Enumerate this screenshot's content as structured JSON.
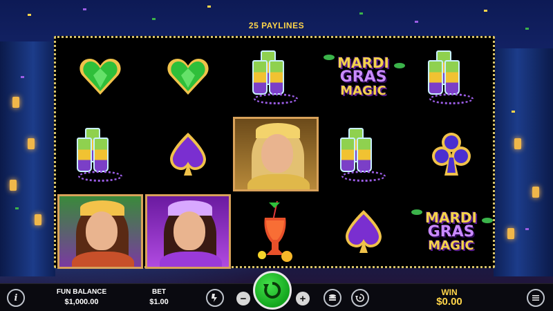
{
  "header": {
    "paylines": "25 PAYLINES"
  },
  "reels": {
    "symbols": [
      [
        "green-heart-gem",
        "green-heart-gem",
        "mardi-gras-shots",
        "mardi-gras-magic-logo",
        "mardi-gras-shots"
      ],
      [
        "mardi-gras-shots",
        "purple-spade",
        "masked-queen-portrait",
        "mardi-gras-shots",
        "purple-club"
      ],
      [
        "showgirl-portrait",
        "purple-showgirl-portrait",
        "hurricane-cocktail",
        "purple-spade",
        "mardi-gras-magic-logo"
      ]
    ]
  },
  "logo": {
    "line1": "MARDI",
    "line2": "GRAS",
    "line3": "MAGIC"
  },
  "bottom_bar": {
    "info_icon": "info-icon",
    "fun_balance_label": "FUN BALANCE",
    "fun_balance_value": "$1,000.00",
    "bet_label": "BET",
    "bet_value": "$1.00",
    "turbo_icon": "lightning-icon",
    "decrease_label": "−",
    "increase_label": "+",
    "spin_icon": "spin-arrow-icon",
    "coin_stack_icon": "coin-stack-icon",
    "autoplay_icon": "autoplay-icon",
    "win_label": "WIN",
    "win_value": "$0.00",
    "menu_icon": "hamburger-menu-icon"
  },
  "colors": {
    "accent_gold": "#ffd54a",
    "spin_green": "#13a61e",
    "board_frame": "#d8c36a"
  }
}
